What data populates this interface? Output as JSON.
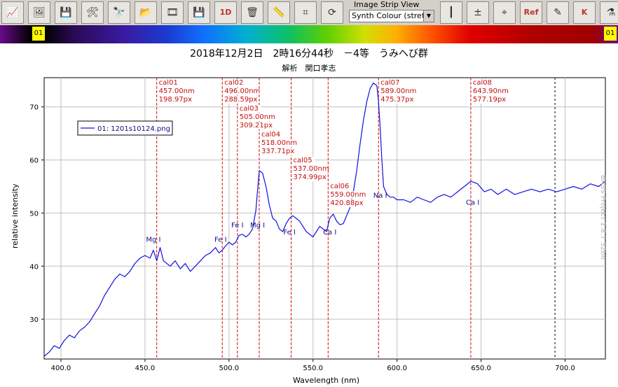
{
  "toolbar": {
    "buttons": [
      {
        "name": "load-spectrum-button",
        "icon": "spectrum-load-icon"
      },
      {
        "name": "open-image-button",
        "icon": "folder-image-icon"
      },
      {
        "name": "save-image-button",
        "icon": "save-image-icon"
      },
      {
        "name": "tools-button",
        "icon": "tools-icon"
      },
      {
        "name": "binoculars-button",
        "icon": "binoculars-icon"
      },
      {
        "name": "open-folder-button",
        "icon": "folder-icon"
      },
      {
        "name": "film-strip-button",
        "icon": "film-strip-icon"
      },
      {
        "name": "save-button",
        "icon": "floppy-disk-icon"
      },
      {
        "name": "save-1d-button",
        "icon": "floppy-1d-icon",
        "label": "1D"
      },
      {
        "name": "delete-button",
        "icon": "trash-icon"
      },
      {
        "name": "ruler-tool-button",
        "icon": "ruler-icon"
      },
      {
        "name": "crop-tool-button",
        "icon": "crop-graph-icon"
      },
      {
        "name": "refresh-button",
        "icon": "refresh-icon"
      },
      {
        "name": "calibration-button",
        "icon": "calibration-lines-icon"
      },
      {
        "name": "math-ops-button",
        "icon": "math-operators-icon"
      },
      {
        "name": "compass-button",
        "icon": "compass-icon"
      },
      {
        "name": "reference-button",
        "icon": "reference-spectrum-icon",
        "label": "Ref"
      },
      {
        "name": "edit-chart-button",
        "icon": "edit-chart-icon"
      },
      {
        "name": "planck-button",
        "icon": "planck-curve-icon",
        "label": "K"
      },
      {
        "name": "flask-button",
        "icon": "flask-icon"
      }
    ],
    "image_strip_label": "Image Strip View",
    "image_strip_value": "Synth Colour (stretc"
  },
  "spectrum_bar": {
    "left_marker": "01",
    "right_marker": "01"
  },
  "header": {
    "title": "2018年12月2日　2時16分44秒　－4等　うみへび群",
    "subtitle": "解析　関口孝志"
  },
  "watermark": "BASS Project 1.8.7 32bit",
  "chart_data": {
    "type": "line",
    "xlabel": "Wavelength (nm)",
    "ylabel": "relative intensity",
    "xlim": [
      390,
      724
    ],
    "ylim": [
      22.5,
      75.5
    ],
    "xticks": [
      400,
      450,
      500,
      550,
      600,
      650,
      700
    ],
    "xtick_labels": [
      "400.0",
      "450.0",
      "500.0",
      "550.0",
      "600.0",
      "650.0",
      "700.0"
    ],
    "yticks": [
      30,
      40,
      50,
      60,
      70
    ],
    "ytick_labels": [
      "30",
      "40",
      "50",
      "60",
      "70"
    ],
    "grid": true,
    "legend": {
      "placement": "top-left"
    },
    "series": [
      {
        "name": "01: 1201s10124.png",
        "color": "#1010e0",
        "x": [
          390,
          393,
          396,
          399,
          402,
          405,
          408,
          411,
          414,
          417,
          420,
          423,
          426,
          429,
          432,
          435,
          438,
          441,
          444,
          447,
          450,
          453,
          455,
          457,
          459,
          461,
          463,
          465,
          468,
          471,
          474,
          477,
          480,
          483,
          486,
          489,
          492,
          494,
          496,
          498,
          500,
          502,
          504,
          506,
          508,
          510,
          512,
          514,
          516,
          518,
          520,
          522,
          524,
          526,
          528,
          530,
          532,
          534,
          536,
          538,
          540,
          542,
          544,
          546,
          548,
          550,
          552,
          554,
          556,
          558,
          560,
          562,
          564,
          566,
          568,
          570,
          572,
          574,
          576,
          578,
          580,
          582,
          584,
          586,
          588,
          589,
          590,
          591,
          592,
          594,
          596,
          598,
          600,
          604,
          608,
          612,
          616,
          620,
          624,
          628,
          632,
          636,
          640,
          644,
          648,
          652,
          656,
          660,
          665,
          670,
          675,
          680,
          685,
          690,
          695,
          700,
          705,
          710,
          715,
          720,
          724
        ],
        "y": [
          23,
          23.8,
          25,
          24.5,
          26,
          27,
          26.5,
          27.8,
          28.5,
          29.5,
          31,
          32.5,
          34.5,
          36,
          37.5,
          38.5,
          38,
          39,
          40.5,
          41.5,
          42,
          41.5,
          43,
          41,
          43.5,
          41,
          40.5,
          40,
          41,
          39.5,
          40.5,
          39,
          40,
          41,
          42,
          42.5,
          43.5,
          42.5,
          43,
          43.8,
          44.5,
          44,
          44.5,
          45.8,
          46,
          45.5,
          46,
          47,
          50.5,
          58,
          57.5,
          55,
          51.5,
          49,
          48.5,
          47,
          46.5,
          48,
          49,
          49.5,
          49,
          48.5,
          47.5,
          46.5,
          46,
          45.5,
          46.5,
          47.5,
          47,
          46.5,
          49,
          49.8,
          48.5,
          47.8,
          48,
          49.5,
          51,
          54,
          58,
          63,
          67.5,
          71,
          73.5,
          74.5,
          74,
          71,
          66,
          60,
          55,
          53.5,
          53,
          53,
          52.5,
          52.5,
          52,
          53,
          52.5,
          52,
          53,
          53.5,
          53,
          54,
          55,
          56,
          55.5,
          54,
          54.5,
          53.5,
          54.5,
          53.5,
          54,
          54.5,
          54,
          54.5,
          54,
          54.5,
          55,
          54.5,
          55.5,
          55,
          56
        ]
      }
    ],
    "calibration_lines": [
      {
        "label": "cal01",
        "nm": 457.0,
        "nm_text": "457.00nm",
        "px_text": "198.97px"
      },
      {
        "label": "cal02",
        "nm": 496.0,
        "nm_text": "496.00nm",
        "px_text": "288.59px"
      },
      {
        "label": "cal03",
        "nm": 505.0,
        "nm_text": "505.00nm",
        "px_text": "309.21px"
      },
      {
        "label": "cal04",
        "nm": 518.0,
        "nm_text": "518.00nm",
        "px_text": "337.71px"
      },
      {
        "label": "cal05",
        "nm": 537.0,
        "nm_text": "537.00nm",
        "px_text": "374.99px"
      },
      {
        "label": "cal06",
        "nm": 559.0,
        "nm_text": "559.00nm",
        "px_text": "420.88px"
      },
      {
        "label": "cal07",
        "nm": 589.0,
        "nm_text": "589.00nm",
        "px_text": "475.37px"
      },
      {
        "label": "cal08",
        "nm": 643.9,
        "nm_text": "643.90nm",
        "px_text": "577.19px"
      }
    ],
    "reference_line": {
      "nm": 694
    },
    "annotations": [
      {
        "text": "Mg I",
        "x": 455,
        "y": 44.6
      },
      {
        "text": "Fe I",
        "x": 495,
        "y": 44.6
      },
      {
        "text": "Fe I",
        "x": 505,
        "y": 47.3
      },
      {
        "text": "Mg I",
        "x": 517,
        "y": 47.3
      },
      {
        "text": "Fe I",
        "x": 536,
        "y": 46.0
      },
      {
        "text": "Ca I",
        "x": 560,
        "y": 46.0
      },
      {
        "text": "Na I",
        "x": 590,
        "y": 52.9
      },
      {
        "text": "Ca I",
        "x": 645,
        "y": 51.6
      }
    ]
  }
}
